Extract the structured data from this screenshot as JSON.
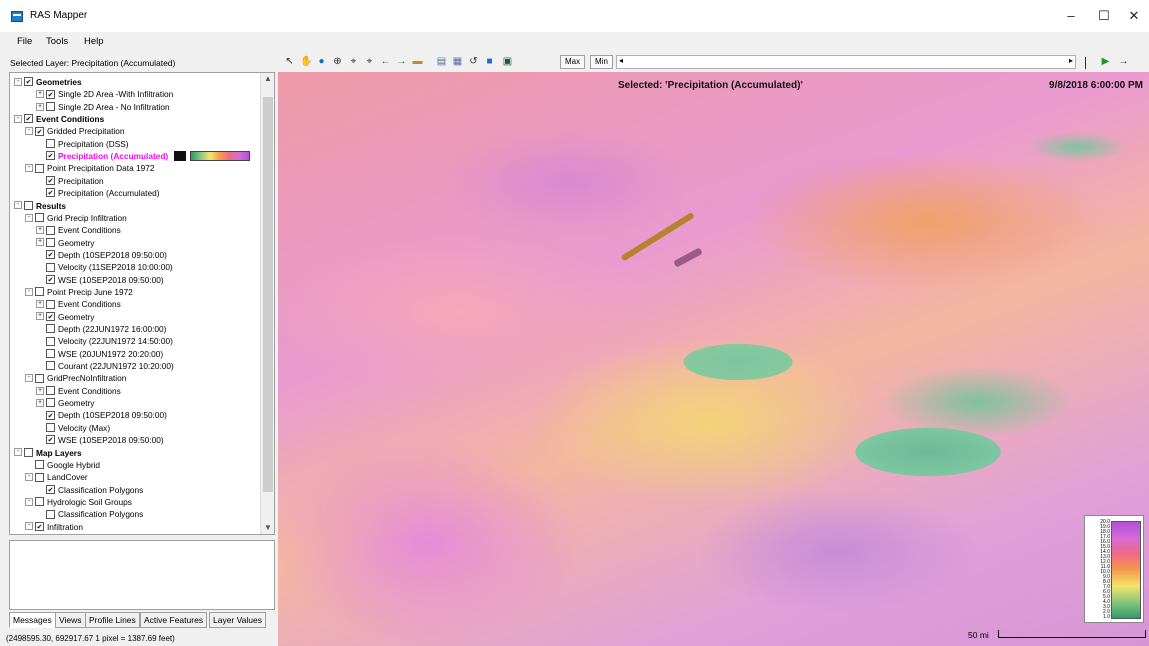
{
  "window": {
    "title": "RAS Mapper",
    "minimize": "–",
    "maximize": "☐",
    "close": "✕"
  },
  "menu": [
    "File",
    "Tools",
    "Help"
  ],
  "selected_layer_label": "Selected Layer: Precipitation (Accumulated)",
  "toolbar": {
    "max_label": "Max",
    "min_label": "Min"
  },
  "tree": [
    {
      "text": "Geometries",
      "bold": true,
      "checked": true
    },
    {
      "text": "Single 2D Area -With Infiltration",
      "checked": true
    },
    {
      "text": "Single 2D Area - No Infiltration",
      "checked": false
    },
    {
      "text": "Event Conditions",
      "bold": true,
      "checked": true
    },
    {
      "text": "Gridded Precipitation",
      "checked": true
    },
    {
      "text": "Precipitation (DSS)",
      "checked": false
    },
    {
      "text": "Precipitation (Accumulated)",
      "checked": true,
      "highlight": true
    },
    {
      "text": "Point Precipitation Data 1972",
      "checked": false
    },
    {
      "text": "Precipitation",
      "checked": true
    },
    {
      "text": "Precipitation (Accumulated)",
      "checked": true
    },
    {
      "text": "Results",
      "bold": true,
      "checked": false
    },
    {
      "text": "Grid Precip Infiltration",
      "checked": false
    },
    {
      "text": "Event Conditions",
      "checked": false
    },
    {
      "text": "Geometry",
      "checked": false
    },
    {
      "text": "Depth (10SEP2018 09:50:00)",
      "checked": true
    },
    {
      "text": "Velocity (11SEP2018 10:00:00)",
      "checked": false
    },
    {
      "text": "WSE (10SEP2018 09:50:00)",
      "checked": true
    },
    {
      "text": "Point Precip June 1972",
      "checked": false
    },
    {
      "text": "Event Conditions",
      "checked": false
    },
    {
      "text": "Geometry",
      "checked": true
    },
    {
      "text": "Depth (22JUN1972 16:00:00)",
      "checked": false
    },
    {
      "text": "Velocity (22JUN1972 14:50:00)",
      "checked": false
    },
    {
      "text": "WSE (20JUN1972 20:20:00)",
      "checked": false
    },
    {
      "text": "Courant (22JUN1972 10:20:00)",
      "checked": false
    },
    {
      "text": "GridPrecNoInfiltration",
      "checked": false
    },
    {
      "text": "Event Conditions",
      "checked": false
    },
    {
      "text": "Geometry",
      "checked": false
    },
    {
      "text": "Depth (10SEP2018 09:50:00)",
      "checked": true
    },
    {
      "text": "Velocity (Max)",
      "checked": false
    },
    {
      "text": "WSE (10SEP2018 09:50:00)",
      "checked": true
    },
    {
      "text": "Map Layers",
      "bold": true,
      "checked": false
    },
    {
      "text": "Google Hybrid",
      "checked": false
    },
    {
      "text": "LandCover",
      "checked": false
    },
    {
      "text": "Classification Polygons",
      "checked": true
    },
    {
      "text": "Hydrologic Soil Groups",
      "checked": false
    },
    {
      "text": "Classification Polygons",
      "checked": false
    },
    {
      "text": "Infiltration",
      "checked": true
    }
  ],
  "tabs": [
    "Messages",
    "Views",
    "Profile Lines",
    "Active Features",
    "Layer Values"
  ],
  "status": "(2498595.30, 692917.67  1 pixel = 1387.69 feet)",
  "map": {
    "selected": "Selected: 'Precipitation (Accumulated)'",
    "time": "9/8/2018 6:00:00 PM",
    "scale_label": "50 mi",
    "legend_ticks": [
      "20.0",
      "19.0",
      "18.0",
      "17.0",
      "16.0",
      "15.0",
      "14.0",
      "13.0",
      "12.0",
      "11.0",
      "10.0",
      "9.0",
      "8.0",
      "7.0",
      "6.0",
      "5.0",
      "4.0",
      "3.0",
      "2.0",
      "1.0"
    ]
  }
}
